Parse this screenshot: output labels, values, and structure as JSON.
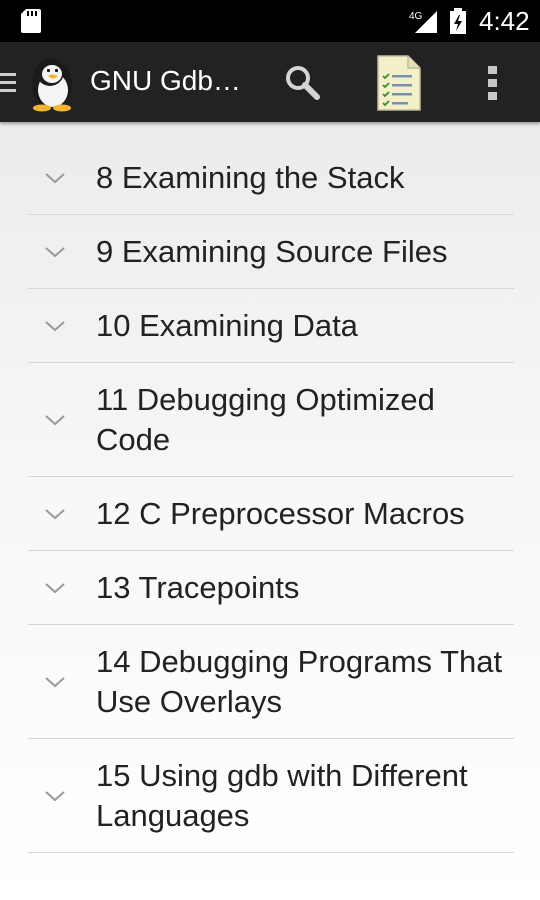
{
  "status_bar": {
    "network_label": "4G",
    "time": "4:42"
  },
  "action_bar": {
    "title": "GNU Gdb…",
    "icons": [
      "menu-drawer-icon",
      "penguin-logo-icon",
      "search-icon",
      "table-of-contents-icon",
      "overflow-menu-icon"
    ]
  },
  "chapters": [
    {
      "label": "8 Examining the Stack",
      "lines": 1
    },
    {
      "label": "9 Examining Source Files",
      "lines": 1
    },
    {
      "label": "10 Examining Data",
      "lines": 1
    },
    {
      "label": "11 Debugging Optimized Code",
      "lines": 2
    },
    {
      "label": "12 C Preprocessor Macros",
      "lines": 1
    },
    {
      "label": "13 Tracepoints",
      "lines": 1
    },
    {
      "label": "14 Debugging Programs That Use Overlays",
      "lines": 2
    },
    {
      "label": "15 Using gdb with Different Languages",
      "lines": 2
    }
  ],
  "colors": {
    "status_bar_bg": "#000000",
    "action_bar_bg": "#222222",
    "text": "#222222",
    "divider": "#d6d6d6",
    "chevron": "#9a9a9a"
  }
}
